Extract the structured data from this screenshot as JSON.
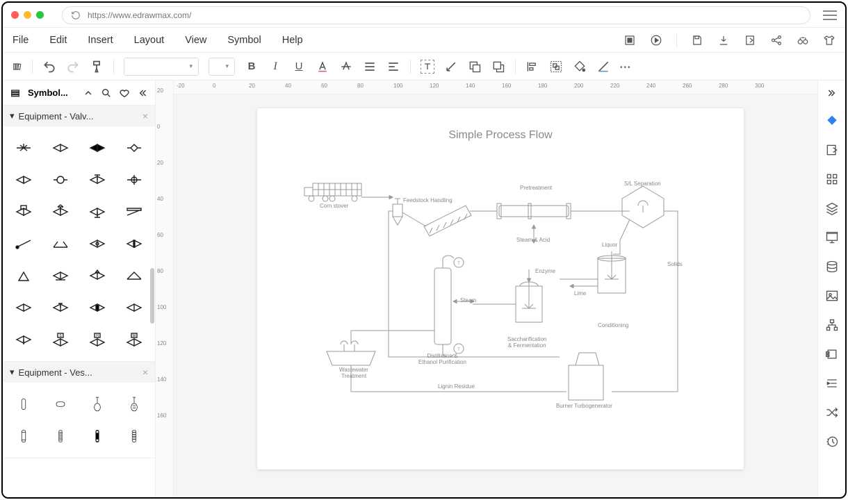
{
  "url": "https://www.edrawmax.com/",
  "menu": {
    "file": "File",
    "edit": "Edit",
    "insert": "Insert",
    "layout": "Layout",
    "view": "View",
    "symbol": "Symbol",
    "help": "Help"
  },
  "leftpanel": {
    "label": "Symbol...",
    "groups": [
      {
        "title": "Equipment - Valv..."
      },
      {
        "title": "Equipment - Ves..."
      }
    ]
  },
  "rulers": {
    "h": [
      "-20",
      "0",
      "20",
      "40",
      "60",
      "80",
      "100",
      "120",
      "140",
      "160",
      "180",
      "200",
      "220",
      "240",
      "260",
      "280",
      "300"
    ],
    "v": [
      "20",
      "0",
      "20",
      "40",
      "60",
      "80",
      "100",
      "120",
      "140",
      "160"
    ]
  },
  "diagram": {
    "title": "Simple Process Flow",
    "labels": {
      "corn_stover": "Corn stover",
      "feedstock": "Feedstock Handling",
      "pretreatment": "Pretreatment",
      "sl_separation": "S/L Separation",
      "steam_acid": "Steam & Acid",
      "liquor": "Liquor",
      "solids": "Solids",
      "enzyme": "Enzyme",
      "lime": "Lime",
      "steam": "Steam",
      "conditioning": "Conditioning",
      "sacc_ferm": "Saccharification\n& Fermentation",
      "distillation": "Distillation &\nEthanol Purification",
      "wastewater": "Wastewater\nTreatment",
      "lignin": "Lignin Residue",
      "burner": "Burner Turbogenerator"
    }
  }
}
